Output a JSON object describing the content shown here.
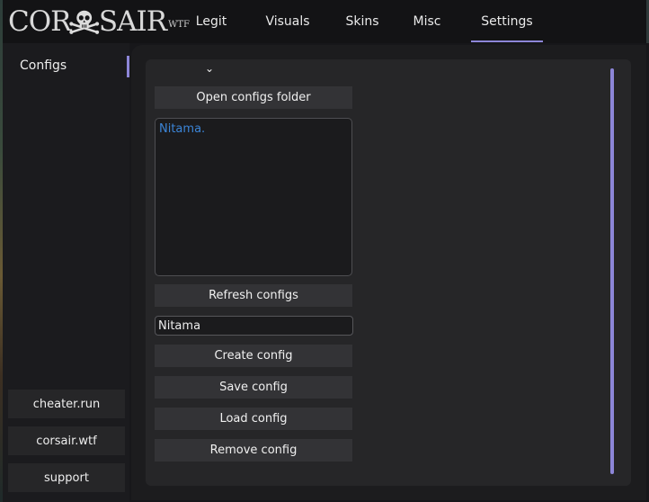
{
  "logo": {
    "text": "COR",
    "text2": "SAIR",
    "suffix": "WTF"
  },
  "tabs": [
    {
      "label": "Legit",
      "active": false
    },
    {
      "label": "Visuals",
      "active": false
    },
    {
      "label": "Skins",
      "active": false
    },
    {
      "label": "Misc",
      "active": false
    },
    {
      "label": "Settings",
      "active": true
    }
  ],
  "sidebar": {
    "items": [
      {
        "label": "Configs",
        "active": true
      }
    ],
    "links": [
      {
        "label": "cheater.run"
      },
      {
        "label": "corsair.wtf"
      },
      {
        "label": "support"
      }
    ]
  },
  "configs": {
    "dropdown_icon": "chevron-down-icon",
    "open_folder_label": "Open configs folder",
    "list": [
      "Nitama."
    ],
    "refresh_label": "Refresh configs",
    "name_input_value": "Nitama",
    "create_label": "Create config",
    "save_label": "Save config",
    "load_label": "Load config",
    "remove_label": "Remove config"
  },
  "colors": {
    "accent": "#8d86d8",
    "list_item": "#3b84d6",
    "background": "#17171a"
  }
}
